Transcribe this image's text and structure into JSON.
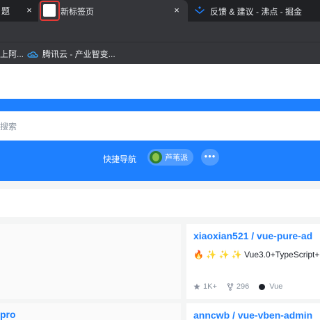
{
  "browser": {
    "tabs": [
      {
        "title": "题",
        "close": "×"
      },
      {
        "title": "新标签页",
        "close": "×"
      },
      {
        "title": "反馈 & 建议 - 沸点 - 掘金"
      }
    ]
  },
  "bookmarks": [
    {
      "label": "上阿..."
    },
    {
      "label": "腾讯云 - 产业智变..."
    }
  ],
  "search": {
    "placeholder": "搜索"
  },
  "quick_nav": {
    "label": "快捷导航",
    "shortcut": "芦苇派",
    "more": "•••"
  },
  "cards": [
    {
      "title": "xiaoxian521 / vue-pure-ad",
      "description": "🔥 ✨ ✨ ✨ Vue3.0+TypeScript+",
      "stars": "1K+",
      "forks": "296",
      "language": "Vue"
    },
    {
      "title": "anncwb / vue-vben-admin"
    }
  ],
  "left_cards": [
    {
      "title": "pro"
    }
  ],
  "colors": {
    "accent": "#1e80ff",
    "tab_bar": "#202124",
    "active_tab": "#35363a",
    "highlight": "#e53935"
  }
}
